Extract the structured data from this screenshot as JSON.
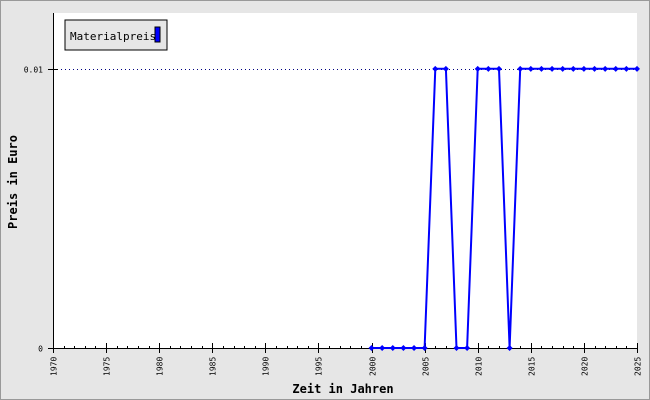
{
  "chart_data": {
    "type": "line",
    "title": "",
    "xlabel": "Zeit in Jahren",
    "ylabel": "Preis in Euro",
    "xlim": [
      1970,
      2025
    ],
    "ylim": [
      0,
      0.012
    ],
    "x_ticks": [
      1970,
      1975,
      1980,
      1985,
      1990,
      1995,
      2000,
      2005,
      2010,
      2015,
      2020,
      2025
    ],
    "x_tick_labels": [
      "1970",
      "1975",
      "1980",
      "1985",
      "1990",
      "1995",
      "2000",
      "2005",
      "2010",
      "2015",
      "2020",
      "2025"
    ],
    "y_ticks": [
      0,
      0.01
    ],
    "y_tick_labels": [
      "0",
      "0.01"
    ],
    "grid": "horizontal dotted at 0.01",
    "legend_position": "top-left",
    "colors": {
      "series": "#0000ff",
      "frame_bg": "#e6e6e6",
      "plot_bg": "#ffffff",
      "grid": "#000080"
    },
    "series": [
      {
        "name": "Materialpreis",
        "x": [
          2000,
          2001,
          2002,
          2003,
          2004,
          2005,
          2006,
          2007,
          2008,
          2009,
          2010,
          2011,
          2012,
          2013,
          2014,
          2015,
          2016,
          2017,
          2018,
          2019,
          2020,
          2021,
          2022,
          2023,
          2024,
          2025
        ],
        "y": [
          0,
          0,
          0,
          0,
          0,
          0,
          0.01,
          0.01,
          0,
          0,
          0.01,
          0.01,
          0.01,
          0,
          0.01,
          0.01,
          0.01,
          0.01,
          0.01,
          0.01,
          0.01,
          0.01,
          0.01,
          0.01,
          0.01,
          0.01
        ]
      }
    ]
  }
}
